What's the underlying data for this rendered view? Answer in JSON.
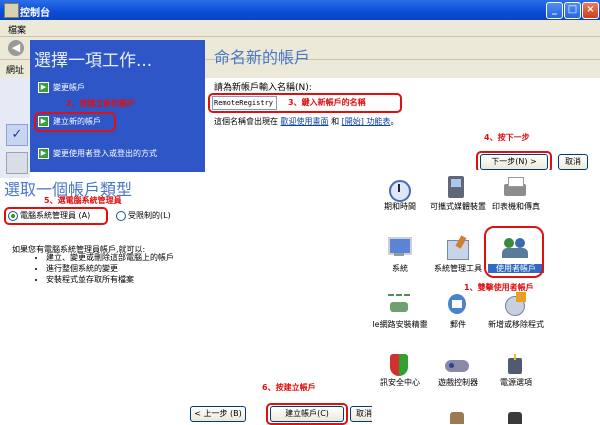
{
  "window": {
    "title": "控制台"
  },
  "background": {
    "menu_fragment": "檔案",
    "address_fragment": "網址"
  },
  "task_pane": {
    "heading": "選擇一項工作...",
    "items": [
      {
        "label": "變更帳戶"
      },
      {
        "label": "建立新的帳戶"
      },
      {
        "label": "變更使用者登入或登出的方式"
      }
    ]
  },
  "name_page": {
    "heading": "命名新的帳戶",
    "prompt": "請為新帳戶輸入名稱(N):",
    "account_name_value": "RemoteRegistry",
    "info_prefix": "這個名稱會出現在",
    "link_welcome": "歡迎使用畫面",
    "info_and": "和",
    "link_start": "[開始] 功能表",
    "info_suffix": "。",
    "next_button": "下一步(N) >",
    "cancel_button": "取消"
  },
  "type_page": {
    "heading": "選取一個帳戶類型",
    "radio_admin": "電腦系統管理員 (A)",
    "radio_limited": "受限制的(L)",
    "desc_intro": "如果您有電腦系統管理員帳戶,就可以:",
    "desc_items": [
      "建立、變更或刪除這部電腦上的帳戶",
      "進行整個系統的變更",
      "安裝程式並存取所有檔案"
    ],
    "back_button": "< 上一步 (B)",
    "create_button": "建立帳戶(C)",
    "cancel_button": "取消"
  },
  "control_panel_icons": [
    {
      "label": "期和時間",
      "icon": "clock-icon"
    },
    {
      "label": "可攜式媒體裝置",
      "icon": "media-device-icon"
    },
    {
      "label": "印表機和傳真",
      "icon": "printer-icon"
    },
    {
      "label": "系統",
      "icon": "system-icon"
    },
    {
      "label": "系統管理工具",
      "icon": "admin-tools-icon"
    },
    {
      "label": "使用者帳戶",
      "icon": "users-icon"
    },
    {
      "label": "le網路安裝精靈",
      "icon": "network-wizard-icon"
    },
    {
      "label": "郵件",
      "icon": "mail-icon"
    },
    {
      "label": "新增或移除程式",
      "icon": "add-remove-icon"
    },
    {
      "label": "訊安全中心",
      "icon": "security-center-icon"
    },
    {
      "label": "遊戲控制器",
      "icon": "game-controller-icon"
    },
    {
      "label": "電源選項",
      "icon": "power-icon"
    }
  ],
  "annotations": {
    "step1": "1、雙擊使用者帳戶",
    "step2": "2、按建立新的帳戶",
    "step3": "3、鍵入新帳戶的名稱",
    "step4": "4、按下一步",
    "step5": "5、選電腦系統管理員",
    "step6": "6、按建立帳戶"
  },
  "colors": {
    "titlebar": "#0a4cd8",
    "task_pane": "#2e56c6",
    "annotation": "#e01010",
    "link": "#0b3fae"
  }
}
